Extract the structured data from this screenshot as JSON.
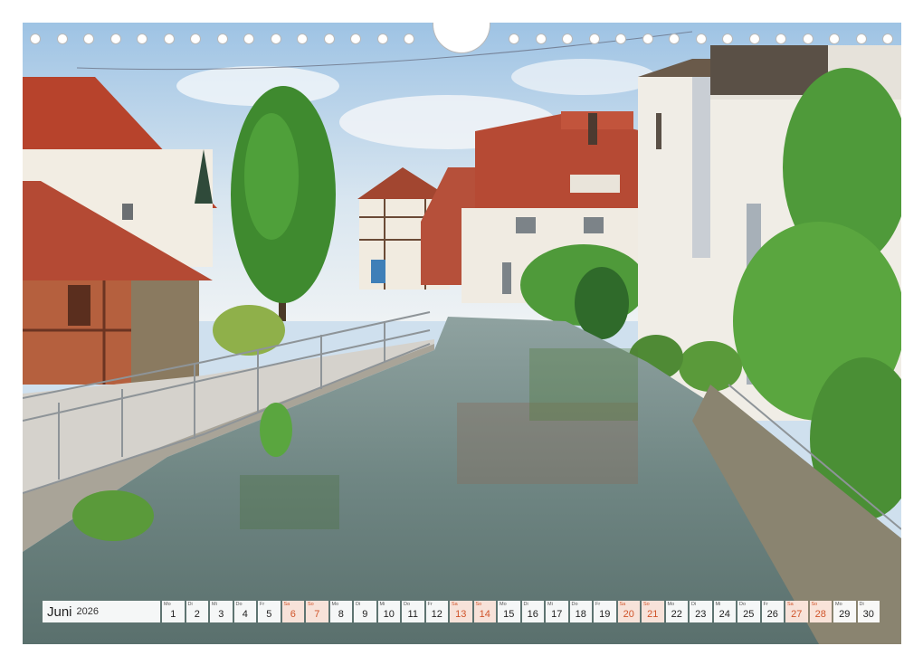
{
  "calendar": {
    "month": "Juni",
    "year": "2026",
    "accent_color": "#d0542a",
    "days": [
      {
        "wd": "Mo",
        "d": "1",
        "weekend": false
      },
      {
        "wd": "Di",
        "d": "2",
        "weekend": false
      },
      {
        "wd": "Mi",
        "d": "3",
        "weekend": false
      },
      {
        "wd": "Do",
        "d": "4",
        "weekend": false
      },
      {
        "wd": "Fr",
        "d": "5",
        "weekend": false
      },
      {
        "wd": "Sa",
        "d": "6",
        "weekend": true
      },
      {
        "wd": "So",
        "d": "7",
        "weekend": true
      },
      {
        "wd": "Mo",
        "d": "8",
        "weekend": false
      },
      {
        "wd": "Di",
        "d": "9",
        "weekend": false
      },
      {
        "wd": "Mi",
        "d": "10",
        "weekend": false
      },
      {
        "wd": "Do",
        "d": "11",
        "weekend": false
      },
      {
        "wd": "Fr",
        "d": "12",
        "weekend": false
      },
      {
        "wd": "Sa",
        "d": "13",
        "weekend": true
      },
      {
        "wd": "So",
        "d": "14",
        "weekend": true
      },
      {
        "wd": "Mo",
        "d": "15",
        "weekend": false
      },
      {
        "wd": "Di",
        "d": "16",
        "weekend": false
      },
      {
        "wd": "Mi",
        "d": "17",
        "weekend": false
      },
      {
        "wd": "Do",
        "d": "18",
        "weekend": false
      },
      {
        "wd": "Fr",
        "d": "19",
        "weekend": false
      },
      {
        "wd": "Sa",
        "d": "20",
        "weekend": true
      },
      {
        "wd": "So",
        "d": "21",
        "weekend": true
      },
      {
        "wd": "Mo",
        "d": "22",
        "weekend": false
      },
      {
        "wd": "Di",
        "d": "23",
        "weekend": false
      },
      {
        "wd": "Mi",
        "d": "24",
        "weekend": false
      },
      {
        "wd": "Do",
        "d": "25",
        "weekend": false
      },
      {
        "wd": "Fr",
        "d": "26",
        "weekend": false
      },
      {
        "wd": "Sa",
        "d": "27",
        "weekend": true
      },
      {
        "wd": "So",
        "d": "28",
        "weekend": true
      },
      {
        "wd": "Mo",
        "d": "29",
        "weekend": false
      },
      {
        "wd": "Di",
        "d": "30",
        "weekend": false
      }
    ]
  },
  "photo": {
    "subject": "canal-town-scene"
  }
}
